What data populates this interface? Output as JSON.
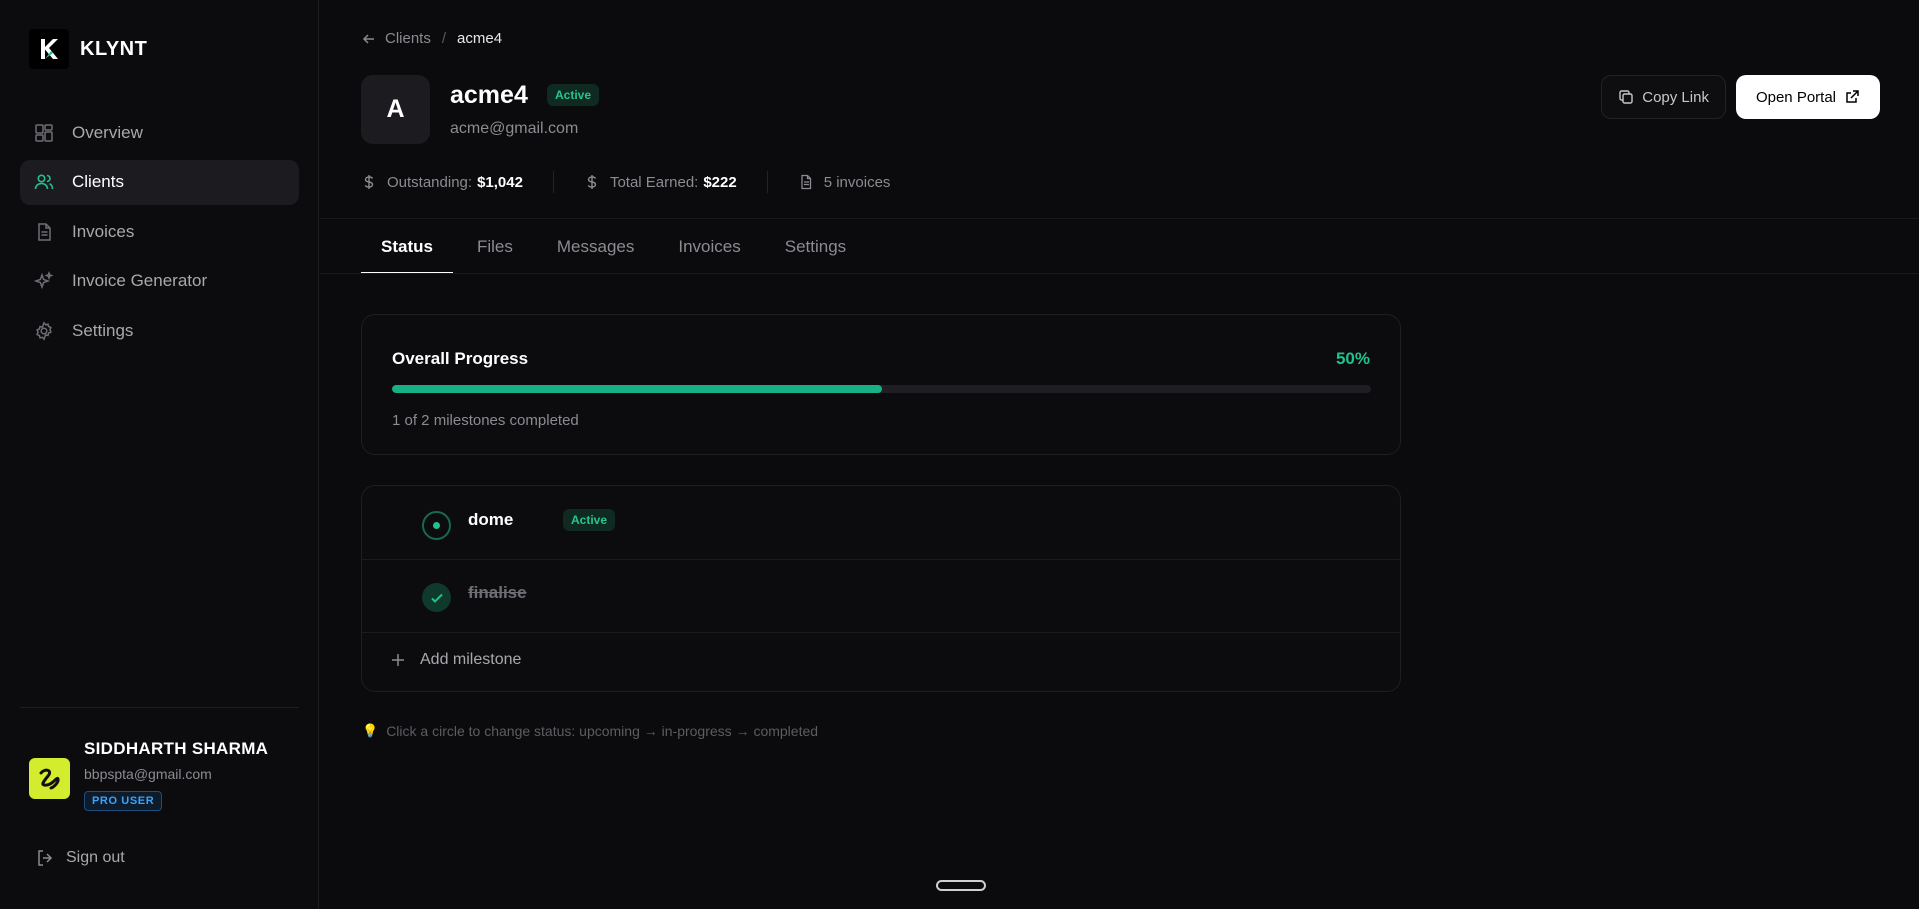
{
  "brand": {
    "name": "KLYNT"
  },
  "nav": [
    {
      "label": "Overview",
      "icon": "grid-icon",
      "active": false
    },
    {
      "label": "Clients",
      "icon": "users-icon",
      "active": true
    },
    {
      "label": "Invoices",
      "icon": "document-icon",
      "active": false
    },
    {
      "label": "Invoice Generator",
      "icon": "sparkles-icon",
      "active": false
    },
    {
      "label": "Settings",
      "icon": "gear-icon",
      "active": false
    }
  ],
  "user": {
    "name": "SIDDHARTH SHARMA",
    "email": "bbpspta@gmail.com",
    "badge": "PRO USER"
  },
  "signout": "Sign out",
  "breadcrumb": {
    "parent": "Clients",
    "separator": "/",
    "current": "acme4"
  },
  "client": {
    "initial": "A",
    "name": "acme4",
    "status": "Active",
    "email": "acme@gmail.com"
  },
  "actions": {
    "copy_link": "Copy Link",
    "open_portal": "Open Portal"
  },
  "stats": {
    "outstanding_label": "Outstanding:",
    "outstanding_value": "$1,042",
    "earned_label": "Total Earned:",
    "earned_value": "$222",
    "invoices": "5 invoices"
  },
  "tabs": [
    {
      "label": "Status",
      "active": true
    },
    {
      "label": "Files",
      "active": false
    },
    {
      "label": "Messages",
      "active": false
    },
    {
      "label": "Invoices",
      "active": false
    },
    {
      "label": "Settings",
      "active": false
    }
  ],
  "progress": {
    "title": "Overall Progress",
    "percent_label": "50%",
    "fraction": 0.5,
    "summary": "1 of 2 milestones completed"
  },
  "milestones": [
    {
      "title": "dome",
      "status": "in-progress",
      "badge": "Active"
    },
    {
      "title": "finalise",
      "status": "completed"
    }
  ],
  "add_milestone": "Add milestone",
  "hint": "Click a circle to change status: upcoming → in-progress → completed",
  "colors": {
    "accent": "#22c08d",
    "background": "#0b0a0c",
    "pro_badge": "#3aa3ff"
  }
}
